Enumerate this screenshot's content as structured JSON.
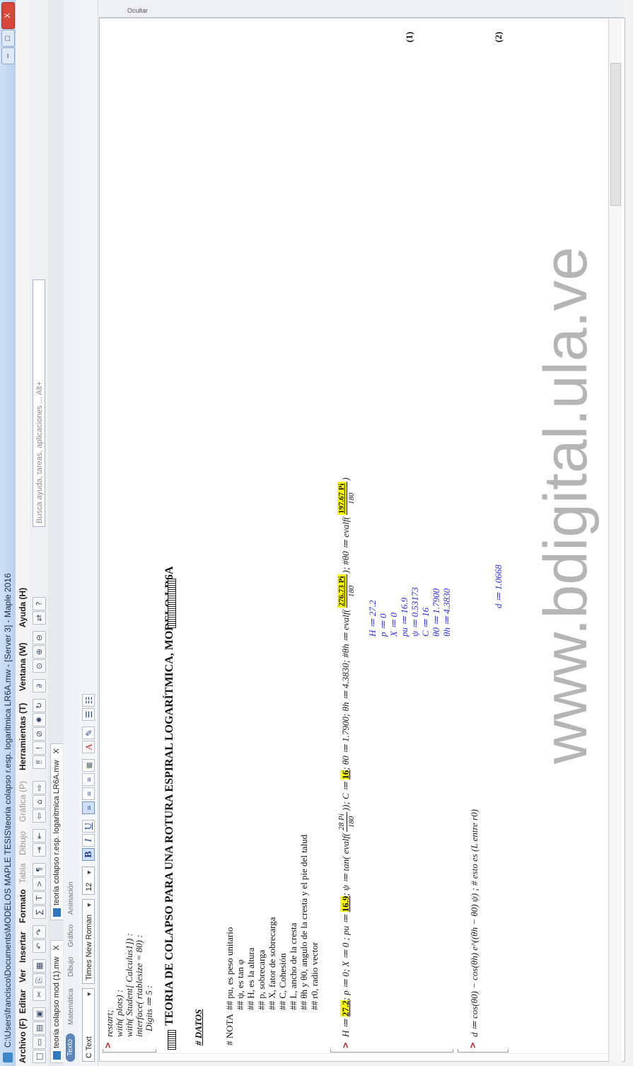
{
  "window": {
    "title": "C:\\Users\\francisco\\Documents\\MODELOS MAPLE TESIS\\teoria colapso r.esp. logaritmica LR6A.mw - [Server 3] - Maple 2016",
    "minimize": "–",
    "maximize": "□",
    "close": "X"
  },
  "menu": [
    {
      "label": "Archivo (F)",
      "enabled": true
    },
    {
      "label": "Editar",
      "enabled": true
    },
    {
      "label": "Ver",
      "enabled": true
    },
    {
      "label": "Insertar",
      "enabled": true
    },
    {
      "label": "Formato",
      "enabled": true
    },
    {
      "label": "Tabla",
      "enabled": false
    },
    {
      "label": "Dibujo",
      "enabled": false
    },
    {
      "label": "Gráfica (P)",
      "enabled": false
    },
    {
      "label": "Herramientas (T)",
      "enabled": true
    },
    {
      "label": "Ventana (W)",
      "enabled": true
    },
    {
      "label": "Ayuda (H)",
      "enabled": true
    }
  ],
  "help_search": {
    "placeholder": "Busca ayuda, tareas, aplicaciones ... Alt+"
  },
  "document_tabs": [
    {
      "label": "teoria colapso mod (1).mw",
      "close": "X"
    },
    {
      "label": "teoria colapso r.esp. logaritmica LR6A.mw",
      "close": "X"
    }
  ],
  "context_tabs": [
    "Texto",
    "Matemática",
    "Dibujo",
    "Gráfico",
    "Animación"
  ],
  "format_bar": {
    "style": "C Text",
    "font": "Times New Roman",
    "size": "12",
    "bold": "B",
    "italic": "I",
    "underline": "U"
  },
  "right_panel": {
    "label": "Ocultar"
  },
  "worksheet": {
    "prompt": ">",
    "block1": [
      "restart;",
      "with( plots) :",
      "with( Student[ Calculus1]) :",
      "interface( rtablesize = 80) :",
      "Digits ≔ 5 :"
    ],
    "title": "TEORIA DE COLAPSO PARA UNA ROTURA ESPIRAL LOGARÍTMICA, MODELO LR6A",
    "datos": "# DATOS",
    "nota_label": "# NOTA",
    "nota_items": [
      "##  pu, es peso unitario",
      "##  ψ, es tan φ",
      "##  H, es la altura",
      "##  p, sobrecarga",
      "##  X, fator de sobrecarga",
      "##  C, Cohesión",
      "##  L, ancho de la cresta",
      "##  θh  y  θ0, angulo de la cresta y el pie del talud",
      "##  r0, radio vector"
    ],
    "eq_input": {
      "h_pre": "H ≔ ",
      "h_val": "27.2",
      "p_part": "; p ≔ 0;  X ≔ 0 ;  pu ≔ ",
      "pu_val": "16.9",
      "psi_part": "; ψ ≔ tan( evalf(",
      "psi_num": "28 Pi",
      "psi_den": "180",
      "c_part": ")); C ≔ ",
      "c_val": "16",
      "theta_part": "; θ0 ≔ 1.7900; θh ≔ 4.3830; #θh ≔ evalf(",
      "th1_num": "276.73 Pi",
      "th1_den": "180",
      "th2_part": "); #θ0 ≔ evalf(",
      "th2_num": "197.67 Pi",
      "th2_den": "180",
      "end": ")"
    },
    "outputs": [
      "H ≔ 27.2",
      "p ≔ 0",
      "X ≔ 0",
      "pu ≔ 16.9",
      "ψ ≔ 0.53173",
      "C ≔ 16",
      "θ0 ≔ 1.7900",
      "θh ≔ 4.3830"
    ],
    "label1": "(1)",
    "d_input": "d ≔ cos(θ0) − cos(θh) e^((θh − θ0) ψ) ;   # esto es (L entre r0)",
    "d_output": "d ≔ 1.0668",
    "label2": "(2)"
  },
  "watermark": "www.bdigital.ula.ve"
}
